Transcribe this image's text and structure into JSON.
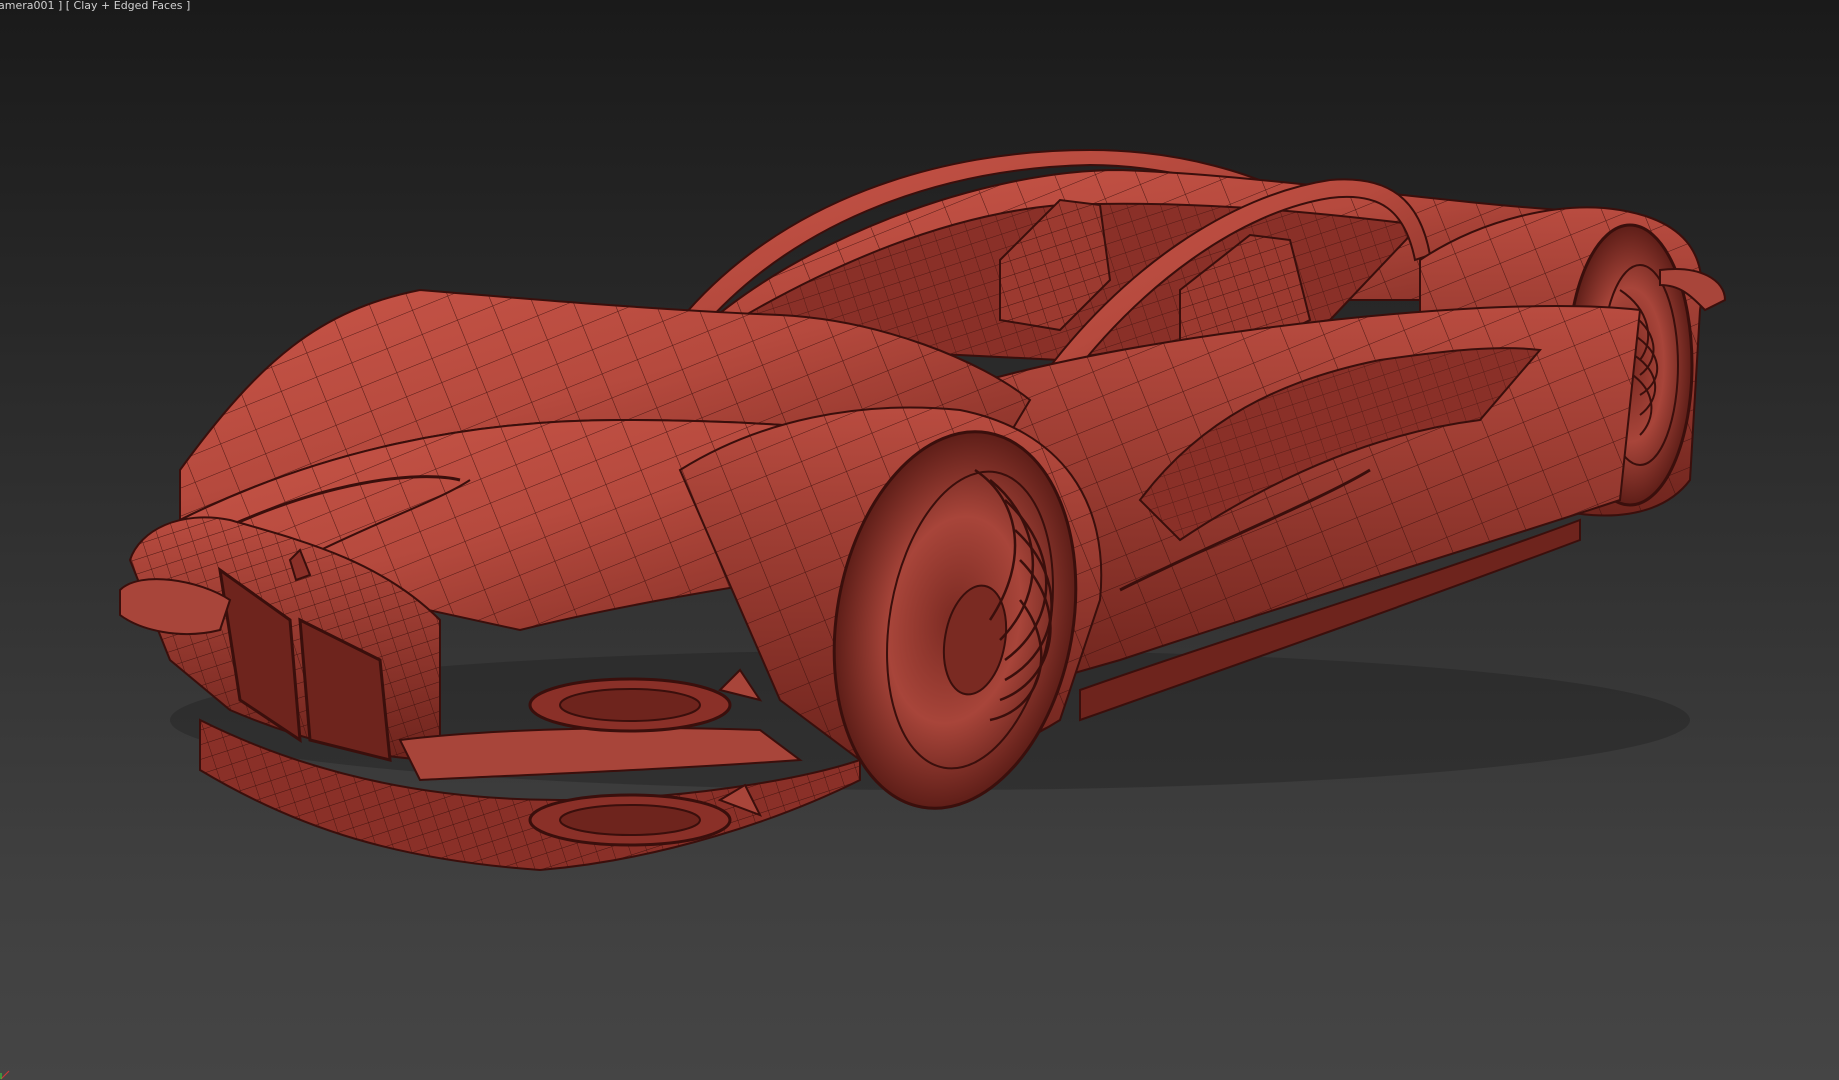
{
  "viewport": {
    "label": "amera001 ] [ Clay + Edged Faces ]",
    "camera_name": "amera001",
    "shading_mode": "Clay + Edged Faces",
    "background_top_color": "#1a1a1a",
    "background_bottom_color": "#454545",
    "model_color": "#b84a3f",
    "edge_color": "#3a0f0c"
  },
  "scene": {
    "object": "sports car clay model",
    "gizmo_icon": "axis-tripod-icon"
  }
}
